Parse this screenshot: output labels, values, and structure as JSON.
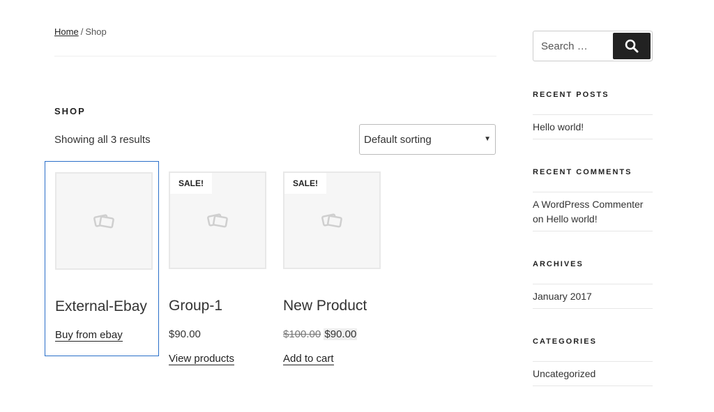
{
  "breadcrumb": {
    "home": "Home",
    "separator": "/",
    "current": "Shop"
  },
  "shop": {
    "title": "SHOP",
    "result_count": "Showing all 3 results",
    "sort": {
      "selected": "Default sorting"
    }
  },
  "products": [
    {
      "title": "External-Ebay",
      "sale_badge": "",
      "price": "",
      "action": "Buy from ebay"
    },
    {
      "title": "Group-1",
      "sale_badge": "SALE!",
      "price": "$90.00",
      "action": "View products"
    },
    {
      "title": "New Product",
      "sale_badge": "SALE!",
      "old_price": "$100.00",
      "new_price": "$90.00",
      "action": "Add to cart"
    }
  ],
  "sidebar": {
    "search": {
      "placeholder": "Search …"
    },
    "recent_posts": {
      "title": "RECENT POSTS",
      "items": [
        "Hello world!"
      ]
    },
    "recent_comments": {
      "title": "RECENT COMMENTS",
      "author": "A WordPress Commenter",
      "on": "on",
      "post": "Hello world!"
    },
    "archives": {
      "title": "ARCHIVES",
      "items": [
        "January 2017"
      ]
    },
    "categories": {
      "title": "CATEGORIES",
      "items": [
        "Uncategorized"
      ]
    }
  },
  "icons": {
    "search": "search-icon",
    "sort": "chevron-down-icon",
    "placeholder": "image-placeholder-icon"
  },
  "colors": {
    "focus_outline": "#2a6fc9",
    "search_button": "#222222"
  }
}
